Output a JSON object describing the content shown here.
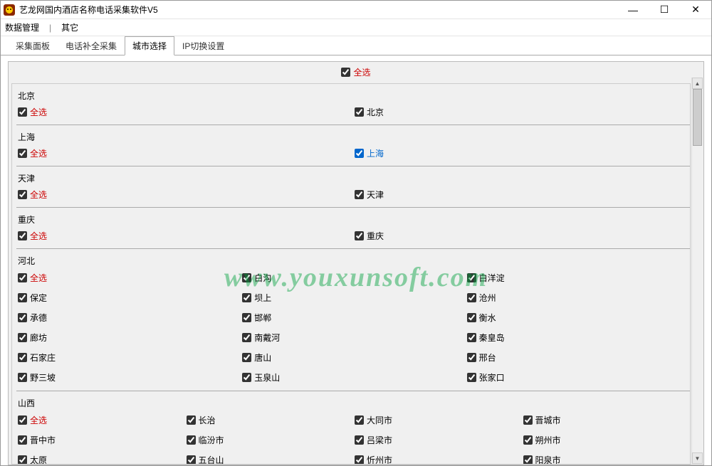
{
  "window": {
    "title": "艺龙网国内酒店名称电话采集软件V5"
  },
  "menu": {
    "item1": "数据管理",
    "sep": "|",
    "item2": "其它"
  },
  "tabs": {
    "t1": "采集面板",
    "t2": "电话补全采集",
    "t3": "城市选择",
    "t4": "IP切换设置"
  },
  "selectAll": "全选",
  "watermark": "www.youxunsoft.com",
  "groups": [
    {
      "name": "北京",
      "cols": 1,
      "selectAll": "全选",
      "items": [
        {
          "label": "北京",
          "blue": false
        }
      ]
    },
    {
      "name": "上海",
      "cols": 1,
      "selectAll": "全选",
      "items": [
        {
          "label": "上海",
          "blue": true
        }
      ]
    },
    {
      "name": "天津",
      "cols": 1,
      "selectAll": "全选",
      "items": [
        {
          "label": "天津",
          "blue": false
        }
      ]
    },
    {
      "name": "重庆",
      "cols": 1,
      "selectAll": "全选",
      "items": [
        {
          "label": "重庆",
          "blue": false
        }
      ]
    },
    {
      "name": "河北",
      "cols": 3,
      "selectAll": "全选",
      "items": [
        {
          "label": "白沟"
        },
        {
          "label": "白洋淀"
        },
        {
          "label": "保定"
        },
        {
          "label": "坝上"
        },
        {
          "label": "沧州"
        },
        {
          "label": "承德"
        },
        {
          "label": "邯郸"
        },
        {
          "label": "衡水"
        },
        {
          "label": "廊坊"
        },
        {
          "label": "南戴河"
        },
        {
          "label": "秦皇岛"
        },
        {
          "label": "石家庄"
        },
        {
          "label": "唐山"
        },
        {
          "label": "邢台"
        },
        {
          "label": "野三坡"
        },
        {
          "label": "玉泉山"
        },
        {
          "label": "张家口"
        }
      ]
    },
    {
      "name": "山西",
      "cols": 4,
      "selectAll": "全选",
      "items": [
        {
          "label": "长治"
        },
        {
          "label": "大同市"
        },
        {
          "label": "晋城市"
        },
        {
          "label": "晋中市"
        },
        {
          "label": "临汾市"
        },
        {
          "label": "吕梁市"
        },
        {
          "label": "朔州市"
        },
        {
          "label": "太原"
        },
        {
          "label": "五台山"
        },
        {
          "label": "忻州市"
        },
        {
          "label": "阳泉市"
        }
      ]
    }
  ]
}
